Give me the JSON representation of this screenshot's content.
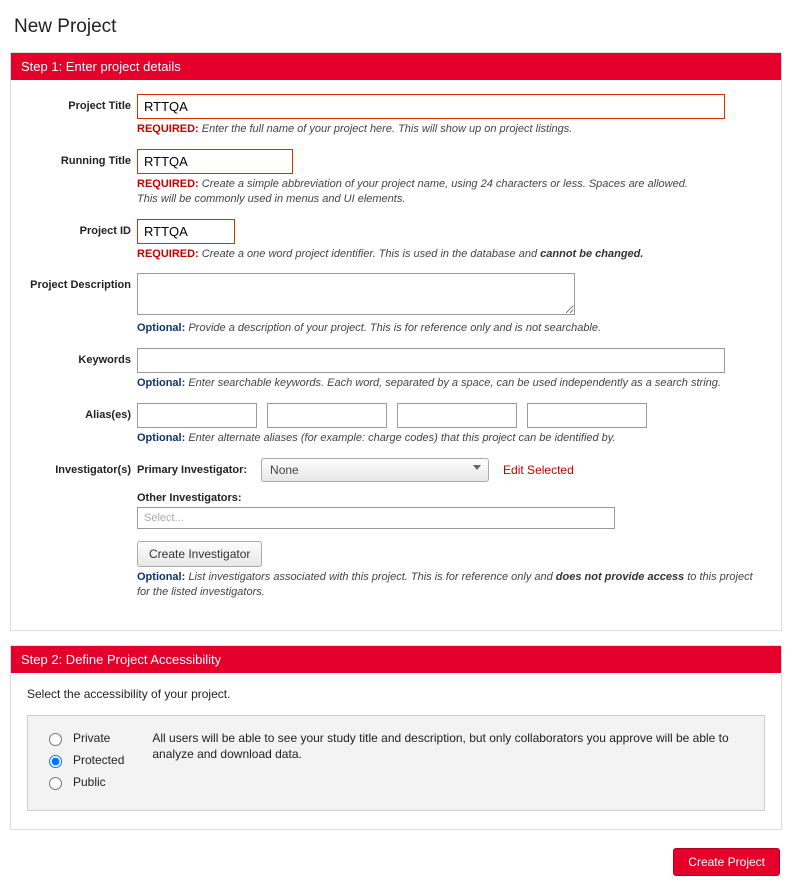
{
  "page_title": "New Project",
  "step1": {
    "header": "Step 1: Enter project details",
    "project_title": {
      "label": "Project Title",
      "value": "RTTQA",
      "help_tag": "REQUIRED:",
      "help": "Enter the full name of your project here. This will show up on project listings."
    },
    "running_title": {
      "label": "Running Title",
      "value": "RTTQA",
      "help_tag": "REQUIRED:",
      "help_line1": "Create a simple abbreviation of your project name, using 24 characters or less. Spaces are allowed.",
      "help_line2": "This will be commonly used in menus and UI elements."
    },
    "project_id": {
      "label": "Project ID",
      "value": "RTTQA",
      "help_tag": "REQUIRED:",
      "help_pre": "Create a one word project identifier. This is used in the database and ",
      "help_bold": "cannot be changed."
    },
    "description": {
      "label": "Project Description",
      "value": "",
      "help_tag": "Optional:",
      "help": "Provide a description of your project. This is for reference only and is not searchable."
    },
    "keywords": {
      "label": "Keywords",
      "value": "",
      "help_tag": "Optional:",
      "help": "Enter searchable keywords. Each word, separated by a space, can be used independently as a search string."
    },
    "aliases": {
      "label": "Alias(es)",
      "values": [
        "",
        "",
        "",
        ""
      ],
      "help_tag": "Optional:",
      "help": "Enter alternate aliases (for example: charge codes) that this project can be identified by."
    },
    "investigators": {
      "label": "Investigator(s)",
      "primary_label": "Primary Investigator:",
      "primary_value": "None",
      "edit_selected": "Edit Selected",
      "other_label": "Other Investigators:",
      "other_placeholder": "Select...",
      "create_btn": "Create Investigator",
      "help_tag": "Optional:",
      "help_pre": "List investigators associated with this project. This is for reference only and ",
      "help_bold": "does not provide access",
      "help_post": " to this project for the listed investigators."
    }
  },
  "step2": {
    "header": "Step 2: Define Project Accessibility",
    "intro": "Select the accessibility of your project.",
    "options": {
      "private": "Private",
      "protected": "Protected",
      "public": "Public"
    },
    "selected": "protected",
    "desc": "All users will be able to see your study title and description, but only collaborators you approve will be able to analyze and download data."
  },
  "footer": {
    "create_project": "Create Project"
  }
}
